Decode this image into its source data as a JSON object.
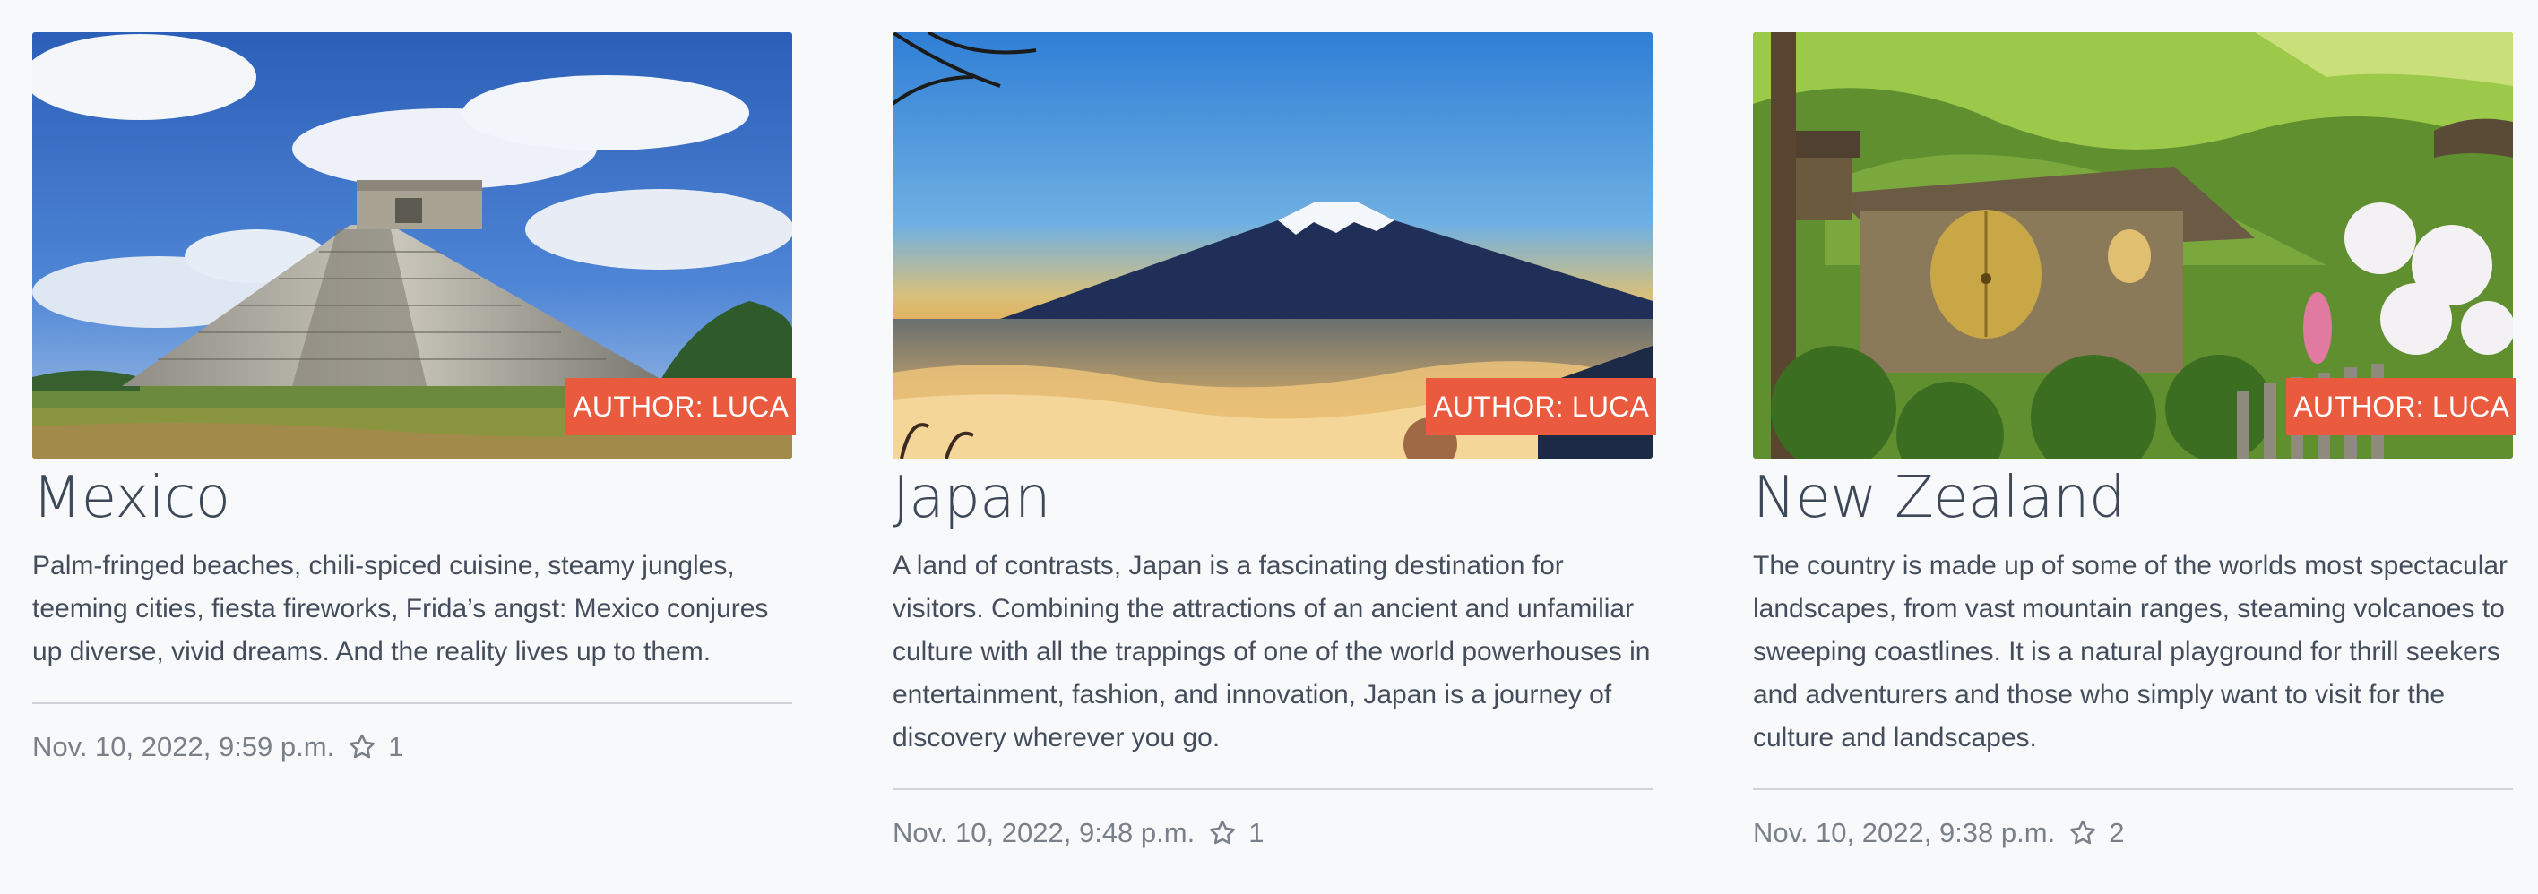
{
  "author_badge": "AUTHOR: LUCA",
  "cards": [
    {
      "image": "chichen-itza-pyramid-photo",
      "title": "Mexico",
      "description": "Palm-fringed beaches, chili-spiced cuisine, steamy jungles, teeming cities, fiesta fireworks, Frida’s angst: Mexico conjures up diverse, vivid dreams. And the reality lives up to them.",
      "date": "Nov. 10, 2022, 9:59 p.m.",
      "stars": "1"
    },
    {
      "image": "mount-fuji-photo",
      "title": "Japan",
      "description": "A land of contrasts, Japan is a fascinating destination for visitors. Combining the attractions of an ancient and unfamiliar culture with all the trappings of one of the world powerhouses in entertainment, fashion, and innovation, Japan is a journey of discovery wherever you go.",
      "date": "Nov. 10, 2022, 9:48 p.m.",
      "stars": "1"
    },
    {
      "image": "hobbit-hole-photo",
      "title": "New Zealand",
      "description": "The country is made up of some of the worlds most spectacular landscapes, from vast mountain ranges, steaming volcanoes to sweeping coastlines. It is a natural playground for thrill seekers and adventurers and those who simply want to visit for the culture and landscapes.",
      "date": "Nov. 10, 2022, 9:38 p.m.",
      "stars": "2"
    }
  ],
  "colors": {
    "badge": "#ea5a3e",
    "text": "#3f4a5a",
    "meta": "#7a8089",
    "background": "#f8f9fb"
  },
  "icons": {
    "rating": "star-outline-icon"
  }
}
